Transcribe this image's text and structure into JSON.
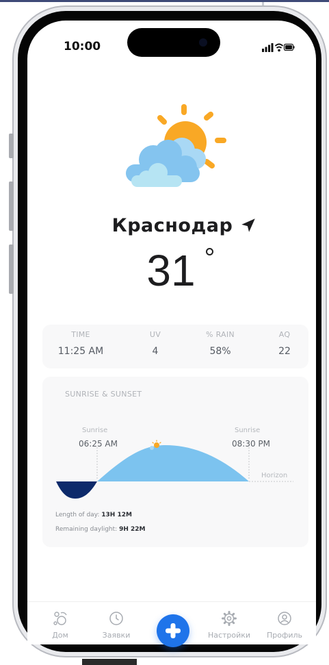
{
  "status_bar": {
    "time": "10:00"
  },
  "location": {
    "city": "Краснодар"
  },
  "weather": {
    "temperature": "31",
    "icon": "partly-cloudy-icon"
  },
  "stats": [
    {
      "label": "TIME",
      "value": "11:25 AM"
    },
    {
      "label": "UV",
      "value": "4"
    },
    {
      "label": "% RAIN",
      "value": "58%"
    },
    {
      "label": "AQ",
      "value": "22"
    }
  ],
  "sun_card": {
    "title": "SUNRISE & SUNSET",
    "sunrise_label": "Sunrise",
    "sunrise_time": "06:25 AM",
    "sunset_label": "Sunrise",
    "sunset_time": "08:30 PM",
    "horizon_label": "Horizon",
    "length_label": "Length of day:",
    "length_value": "13H 12M",
    "remaining_label": "Remaining daylight:",
    "remaining_value": "9H 22M"
  },
  "tabs": [
    {
      "label": "Дом",
      "icon": "home-icon"
    },
    {
      "label": "Заявки",
      "icon": "clock-icon"
    },
    {
      "label": "Настройки",
      "icon": "gear-icon"
    },
    {
      "label": "Профиль",
      "icon": "profile-icon"
    }
  ],
  "fab": {
    "icon": "plus-icon"
  },
  "colors": {
    "accent": "#1f74ea",
    "sun": "#f9a825",
    "day_arc": "#7cc3ef",
    "night_arc": "#0d2a6b"
  }
}
